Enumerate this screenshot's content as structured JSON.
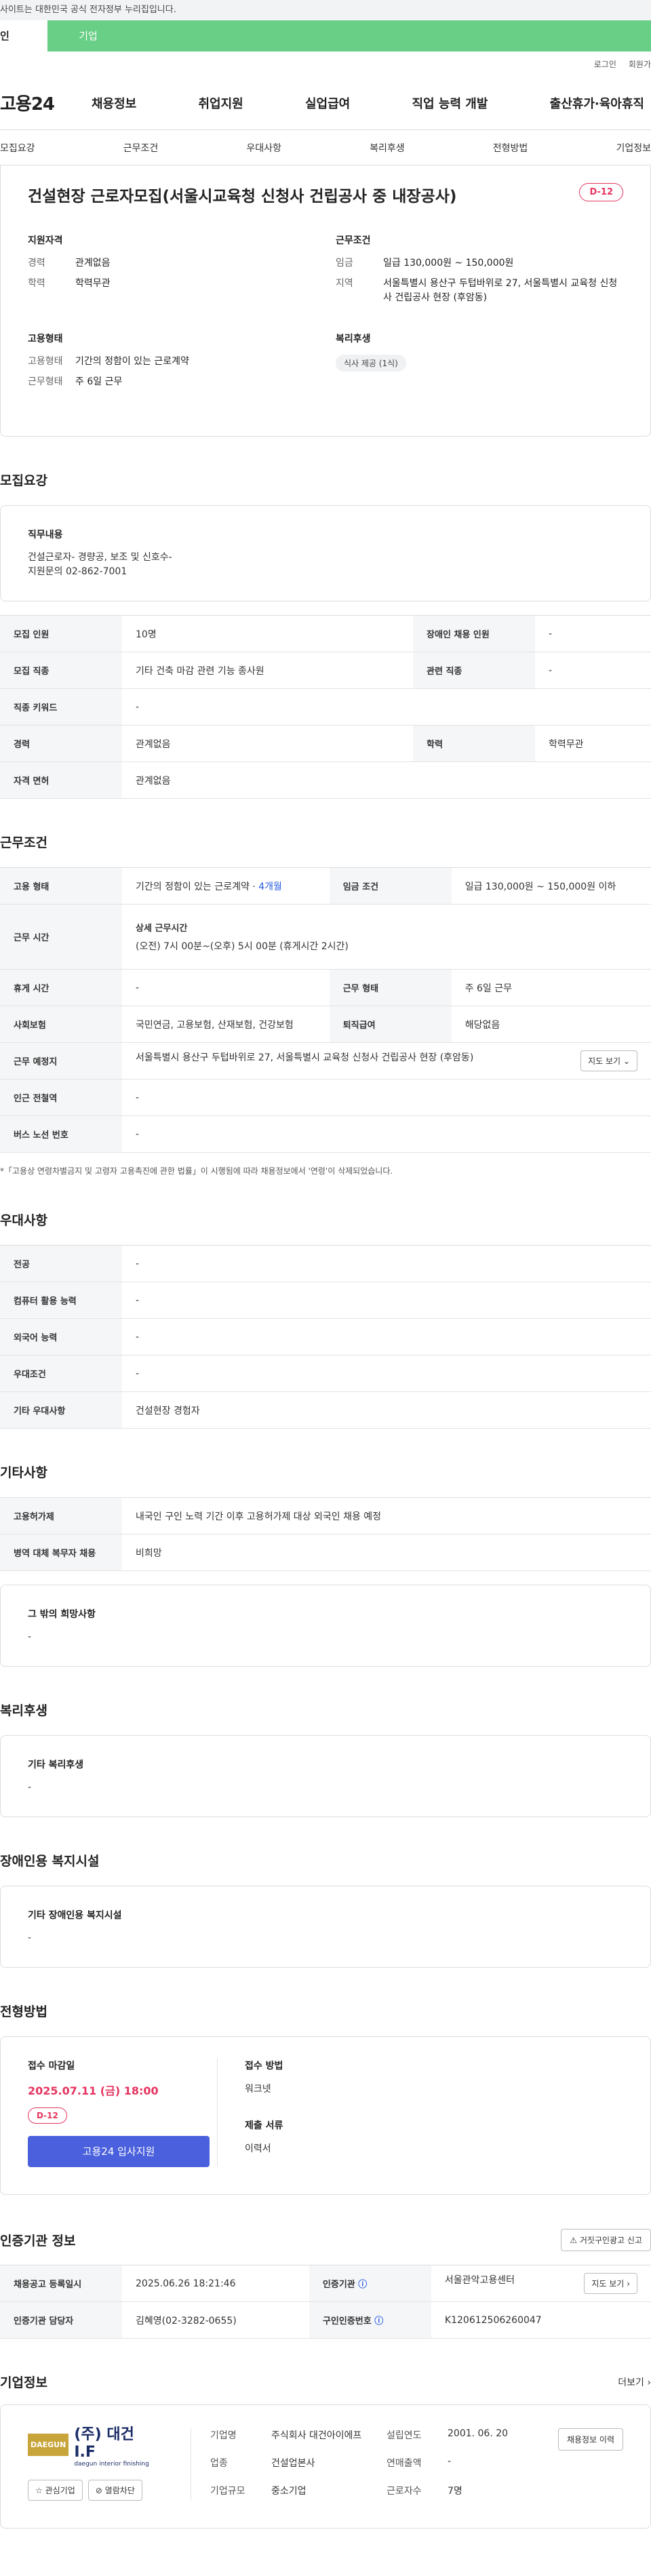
{
  "gov_notice": "사이트는 대한민국 공식 전자정부 누리집입니다.",
  "user_tabs": [
    "인",
    "기업"
  ],
  "util": {
    "login": "로그인",
    "signup": "회원가"
  },
  "gnb": {
    "logo": "고용24",
    "menu": [
      "채용정보",
      "취업지원",
      "실업급여",
      "직업 능력 개발",
      "출산휴가·육아휴직"
    ]
  },
  "anchors": [
    "모집요강",
    "근무조건",
    "우대사항",
    "복리후생",
    "전형방법",
    "기업정보"
  ],
  "summary": {
    "title": "건설현장 근로자모집(서울시교육청 신청사 건립공사 중 내장공사)",
    "dday": "D-12",
    "groups": [
      {
        "heading": "지원자격",
        "rows": [
          {
            "k": "경력",
            "v": "관계없음"
          },
          {
            "k": "학력",
            "v": "학력무관"
          }
        ]
      },
      {
        "heading": "근무조건",
        "rows": [
          {
            "k": "임금",
            "v": "일급 130,000원 ~ 150,000원"
          },
          {
            "k": "지역",
            "v": "서울특별시 용산구 두텁바위로 27, 서울특별시 교육청 신청사 건립공사 현장 (후암동)"
          }
        ]
      },
      {
        "heading": "고용형태",
        "rows": [
          {
            "k": "고용형태",
            "v": "기간의 정함이 있는 근로계약"
          },
          {
            "k": "근무형태",
            "v": "주 6일 근무"
          }
        ]
      },
      {
        "heading": "복리후생",
        "chip": "식사 제공 (1식)"
      }
    ]
  },
  "recruit": {
    "section_title": "모집요강",
    "duty_heading": "직무내용",
    "duty_text": "건설근로자- 경량공, 보조 및 신호수-\n지원문의 02-862-7001",
    "table": {
      "r1": {
        "k1": "모집 인원",
        "v1": "10명",
        "k2": "장애인 채용 인원",
        "v2": "-"
      },
      "r2": {
        "k1": "모집 직종",
        "v1": "기타 건축 마감 관련 기능 종사원",
        "k2": "관련 직종",
        "v2": "-"
      },
      "r3": {
        "k1": "직종 키워드",
        "v1": "-"
      },
      "r4": {
        "k1": "경력",
        "v1": "관계없음",
        "k2": "학력",
        "v2": "학력무관"
      },
      "r5": {
        "k1": "자격 면허",
        "v1": "관계없음"
      }
    }
  },
  "work": {
    "section_title": "근무조건",
    "r1": {
      "k1": "고용 형태",
      "v1": "기간의 정함이 있는 근로계약 · ",
      "v1b": "4개월",
      "k2": "임금 조건",
      "v2": "일급 130,000원 ~ 150,000원 이하"
    },
    "r2": {
      "k1": "근무 시간",
      "v1h": "상세 근무시간",
      "v1": "(오전) 7시 00분~(오후) 5시 00분 (휴게시간 2시간)"
    },
    "r3": {
      "k1": "휴게 시간",
      "v1": "-",
      "k2": "근무 형태",
      "v2": "주 6일 근무"
    },
    "r4": {
      "k1": "사회보험",
      "v1": "국민연금, 고용보험, 산재보험, 건강보험",
      "k2": "퇴직급여",
      "v2": "해당없음"
    },
    "r5": {
      "k1": "근무 예정지",
      "v1": "서울특별시 용산구 두텁바위로 27, 서울특별시 교육청 신청사 건립공사 현장 (후암동)",
      "btn": "지도 보기"
    },
    "r6": {
      "k1": "인근 전철역",
      "v1": "-"
    },
    "r7": {
      "k1": "버스 노선 번호",
      "v1": "-"
    },
    "note": "*「고용상 연령차별금지 및 고령자 고용촉진에 관한 법률」이 시행됨에 따라 채용정보에서 '연령'이 삭제되었습니다."
  },
  "pref": {
    "section_title": "우대사항",
    "rows": [
      {
        "k": "전공",
        "v": "-"
      },
      {
        "k": "컴퓨터 활용 능력",
        "v": "-"
      },
      {
        "k": "외국어 능력",
        "v": "-"
      },
      {
        "k": "우대조건",
        "v": "-"
      },
      {
        "k": "기타 우대사항",
        "v": "건설현장 경험자"
      }
    ]
  },
  "etc": {
    "section_title": "기타사항",
    "rows": [
      {
        "k": "고용허가제",
        "v": "내국인 구인 노력 기간 이후 고용허가제 대상 외국인 채용 예정"
      },
      {
        "k": "병역 대체 복무자 채용",
        "v": "비희망"
      }
    ],
    "box_h": "그 밖의 희망사항",
    "box_t": "-"
  },
  "welfare": {
    "section_title": "복리후생",
    "box_h": "기타 복리후생",
    "box_t": "-"
  },
  "disabled": {
    "section_title": "장애인용 복지시설",
    "box_h": "기타 장애인용 복지시설",
    "box_t": "-"
  },
  "screening": {
    "section_title": "전형방법",
    "deadline_h": "접수 마감일",
    "deadline": "2025.07.11 (금) 18:00",
    "dday": "D-12",
    "apply_btn": "고용24 입사지원",
    "method_h": "접수 방법",
    "method": "워크넷",
    "docs_h": "제출 서류",
    "docs": "이력서"
  },
  "agency": {
    "section_title": "인증기관 정보",
    "report_btn": "거짓구인광고 신고",
    "r1": {
      "k1": "채용공고 등록일시",
      "v1": "2025.06.26 18:21:46",
      "k2": "인증기관",
      "v2": "서울관악고용센터",
      "btn": "지도 보기"
    },
    "r2": {
      "k1": "인증기관 담당자",
      "v1": "김혜영(02-3282-0655)",
      "k2": "구인인증번호",
      "v2": "K120612506260047"
    }
  },
  "company": {
    "section_title": "기업정보",
    "more": "더보기",
    "logo_mark": "DAEGUN",
    "logo_name": "(주) 대건 I.F",
    "logo_sub": "daegun interior finishing",
    "fav_btn": "관심기업",
    "block_btn": "열람차단",
    "history_btn": "채용정보 이력",
    "info": [
      {
        "k": "기업명",
        "v": "주식회사 대건아이에프"
      },
      {
        "k": "설립연도",
        "v": "2001. 06. 20"
      },
      {
        "k": "업종",
        "v": "건설업본사"
      },
      {
        "k": "연매출액",
        "v": "-"
      },
      {
        "k": "기업규모",
        "v": "중소기업"
      },
      {
        "k": "근로자수",
        "v": "7명"
      }
    ]
  },
  "colors": {
    "brand_green": "#69cf86",
    "dday_red": "#e5345f",
    "apply_blue": "#4a60dd"
  }
}
